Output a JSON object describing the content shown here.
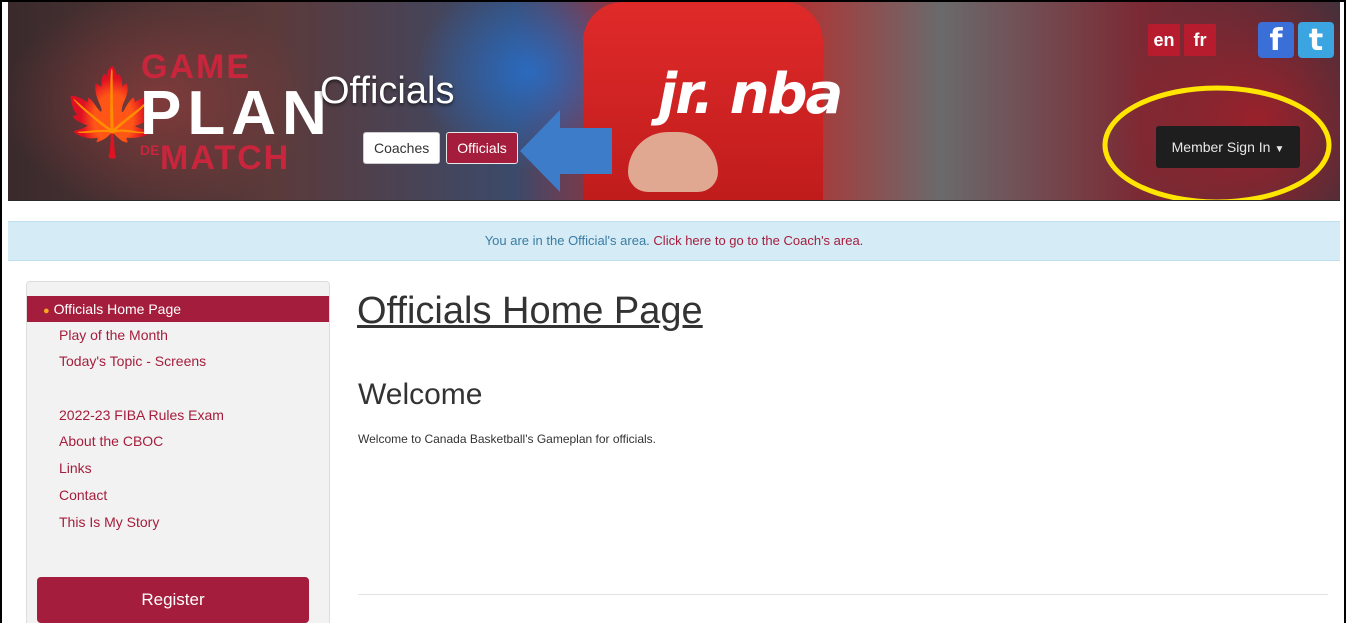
{
  "header": {
    "logo": {
      "game": "GAME",
      "plan": "PLAN",
      "de": "DE",
      "match": "MATCH",
      "leaf": "🍁"
    },
    "page_heading": "Officials",
    "subnav": [
      {
        "label": "Coaches"
      },
      {
        "label": "Officials"
      }
    ],
    "language": [
      {
        "label": "en"
      },
      {
        "label": "fr"
      }
    ],
    "social": [
      {
        "label": "f",
        "icon": "facebook-icon"
      },
      {
        "label": "t",
        "icon": "twitter-icon"
      }
    ],
    "member_signin": "Member Sign In",
    "shirt_text": "jr. nba"
  },
  "infobar": {
    "text": "You are in the Official's area.",
    "link": "Click here to go to the Coach's area."
  },
  "sidebar": {
    "items": [
      {
        "label": "Officials Home Page",
        "active": true
      },
      {
        "label": "Play of the Month"
      },
      {
        "label": "Today's Topic - Screens"
      },
      {
        "label": "2022-23 FIBA Rules Exam"
      },
      {
        "label": "About the CBOC"
      },
      {
        "label": "Links"
      },
      {
        "label": "Contact"
      },
      {
        "label": "This Is My Story"
      }
    ],
    "register_label": "Register"
  },
  "main": {
    "title": "Officials Home Page",
    "subtitle": "Welcome",
    "body": "Welcome to Canada Basketball's Gameplan for officials."
  },
  "colors": {
    "brand_red": "#a51d3c",
    "info_bg": "#d5ebf5",
    "highlight_yellow": "#ffe600",
    "annotation_arrow": "#3d7cc9"
  }
}
